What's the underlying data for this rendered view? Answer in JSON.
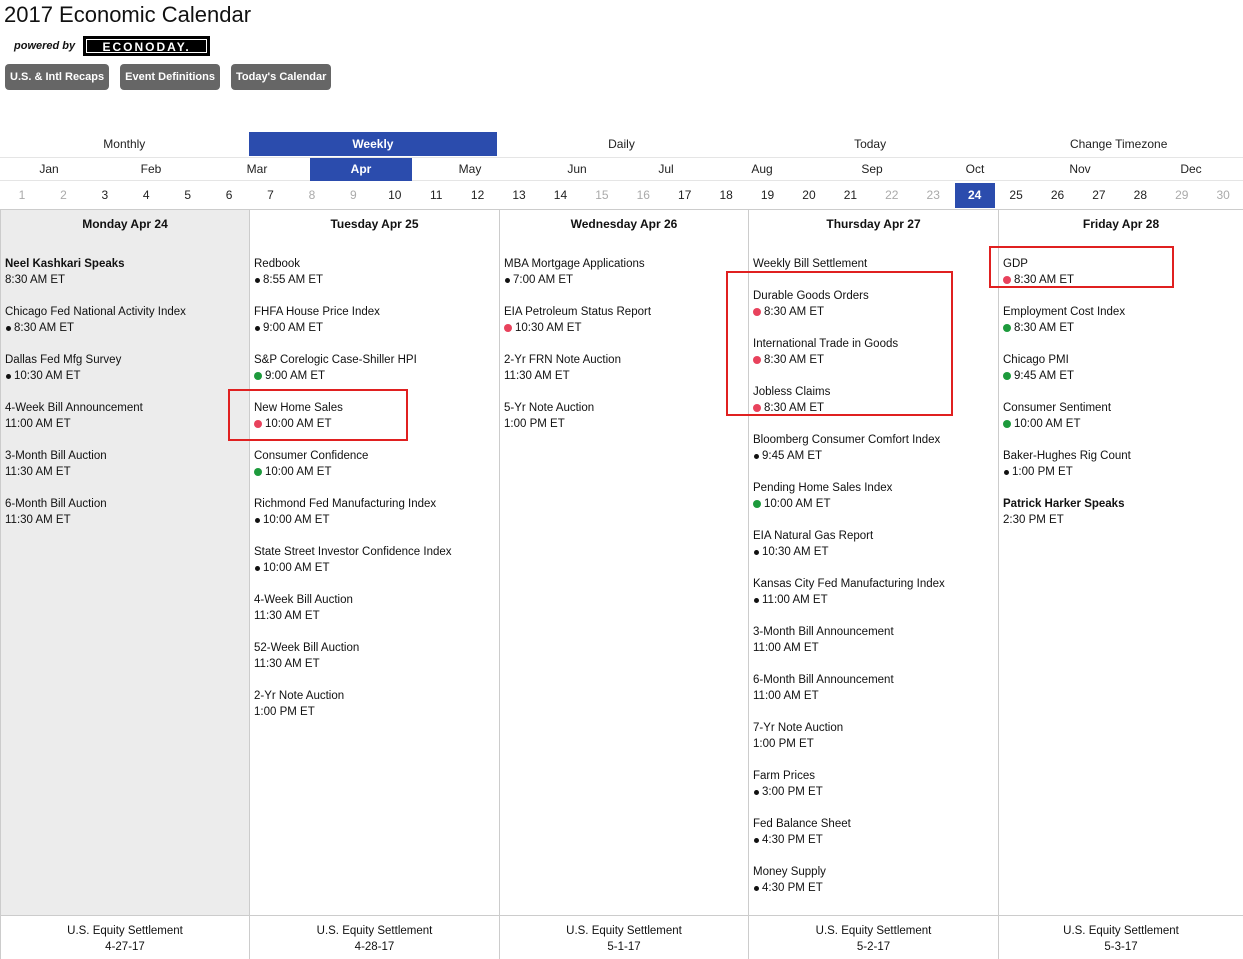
{
  "header": {
    "title": "2017 Economic Calendar",
    "powered_by": "powered by",
    "logo_text": "ECONODAY."
  },
  "buttons": [
    "U.S. & Intl Recaps",
    "Event Definitions",
    "Today's Calendar"
  ],
  "views": [
    {
      "label": "Monthly",
      "active": false
    },
    {
      "label": "Weekly",
      "active": true
    },
    {
      "label": "Daily",
      "active": false
    },
    {
      "label": "Today",
      "active": false
    },
    {
      "label": "Change Timezone",
      "active": false
    }
  ],
  "months": [
    "Jan",
    "Feb",
    "Mar",
    "Apr",
    "May",
    "Jun",
    "Jul",
    "Aug",
    "Sep",
    "Oct",
    "Nov",
    "Dec"
  ],
  "active_month": "Apr",
  "days": [
    "1",
    "2",
    "3",
    "4",
    "5",
    "6",
    "7",
    "8",
    "9",
    "10",
    "11",
    "12",
    "13",
    "14",
    "15",
    "16",
    "17",
    "18",
    "19",
    "20",
    "21",
    "22",
    "23",
    "24",
    "25",
    "26",
    "27",
    "28",
    "29",
    "30"
  ],
  "dim_days": [
    "1",
    "2",
    "8",
    "9",
    "15",
    "16",
    "22",
    "23",
    "29",
    "30"
  ],
  "active_day": "24",
  "columns": [
    {
      "heading": "Monday Apr 24",
      "shaded": true,
      "events": [
        {
          "name": "Neel Kashkari Speaks",
          "bold": true,
          "time": "8:30 AM ET",
          "dot": ""
        },
        {
          "name": "Chicago Fed National Activity Index",
          "time": "8:30 AM ET",
          "dot": "black"
        },
        {
          "name": "Dallas Fed Mfg Survey",
          "time": "10:30 AM ET",
          "dot": "black"
        },
        {
          "name": "4-Week Bill Announcement",
          "time": "11:00 AM ET",
          "dot": ""
        },
        {
          "name": "3-Month Bill Auction",
          "time": "11:30 AM ET",
          "dot": ""
        },
        {
          "name": "6-Month Bill Auction",
          "time": "11:30 AM ET",
          "dot": ""
        }
      ],
      "footer": {
        "label": "U.S. Equity Settlement",
        "date": "4-27-17"
      }
    },
    {
      "heading": "Tuesday Apr 25",
      "events": [
        {
          "name": "Redbook",
          "time": "8:55 AM ET",
          "dot": "black"
        },
        {
          "name": "FHFA House Price Index",
          "time": "9:00 AM ET",
          "dot": "black"
        },
        {
          "name": "S&P Corelogic Case-Shiller HPI",
          "time": "9:00 AM ET",
          "dot": "green"
        },
        {
          "name": "New Home Sales",
          "time": "10:00 AM ET",
          "dot": "red"
        },
        {
          "name": "Consumer Confidence",
          "time": "10:00 AM ET",
          "dot": "green"
        },
        {
          "name": "Richmond Fed Manufacturing Index",
          "time": "10:00 AM ET",
          "dot": "black"
        },
        {
          "name": "State Street Investor Confidence Index",
          "time": "10:00 AM ET",
          "dot": "black"
        },
        {
          "name": "4-Week Bill Auction",
          "time": "11:30 AM ET",
          "dot": ""
        },
        {
          "name": "52-Week Bill Auction",
          "time": "11:30 AM ET",
          "dot": ""
        },
        {
          "name": "2-Yr Note Auction",
          "time": "1:00 PM ET",
          "dot": ""
        }
      ],
      "footer": {
        "label": "U.S. Equity Settlement",
        "date": "4-28-17"
      }
    },
    {
      "heading": "Wednesday Apr 26",
      "events": [
        {
          "name": "MBA Mortgage Applications",
          "time": "7:00 AM ET",
          "dot": "black"
        },
        {
          "name": "EIA Petroleum Status Report",
          "time": "10:30 AM ET",
          "dot": "red"
        },
        {
          "name": "2-Yr FRN Note Auction",
          "time": "11:30 AM ET",
          "dot": ""
        },
        {
          "name": "5-Yr Note Auction",
          "time": "1:00 PM ET",
          "dot": ""
        }
      ],
      "footer": {
        "label": "U.S. Equity Settlement",
        "date": "5-1-17"
      }
    },
    {
      "heading": "Thursday Apr 27",
      "first_event_short": true,
      "events": [
        {
          "name": "Weekly Bill Settlement",
          "time": "",
          "dot": ""
        },
        {
          "name": "Durable Goods Orders",
          "time": "8:30 AM ET",
          "dot": "red"
        },
        {
          "name": "International Trade in Goods",
          "time": "8:30 AM ET",
          "dot": "red"
        },
        {
          "name": "Jobless Claims",
          "time": "8:30 AM ET",
          "dot": "red"
        },
        {
          "name": "Bloomberg Consumer Comfort Index",
          "time": "9:45 AM ET",
          "dot": "black"
        },
        {
          "name": "Pending Home Sales Index",
          "time": "10:00 AM ET",
          "dot": "green"
        },
        {
          "name": "EIA Natural Gas Report",
          "time": "10:30 AM ET",
          "dot": "black"
        },
        {
          "name": "Kansas City Fed Manufacturing Index",
          "time": "11:00 AM ET",
          "dot": "black"
        },
        {
          "name": "3-Month Bill Announcement",
          "time": "11:00 AM ET",
          "dot": ""
        },
        {
          "name": "6-Month Bill Announcement",
          "time": "11:00 AM ET",
          "dot": ""
        },
        {
          "name": "7-Yr Note Auction",
          "time": "1:00 PM ET",
          "dot": ""
        },
        {
          "name": "Farm Prices",
          "time": "3:00 PM ET",
          "dot": "black"
        },
        {
          "name": "Fed Balance Sheet",
          "time": "4:30 PM ET",
          "dot": "black"
        },
        {
          "name": "Money Supply",
          "time": "4:30 PM ET",
          "dot": "black"
        }
      ],
      "footer": {
        "label": "U.S. Equity Settlement",
        "date": "5-2-17"
      }
    },
    {
      "heading": "Friday Apr 28",
      "events": [
        {
          "name": "GDP",
          "time": "8:30 AM ET",
          "dot": "red"
        },
        {
          "name": "Employment Cost Index",
          "time": "8:30 AM ET",
          "dot": "green"
        },
        {
          "name": "Chicago PMI",
          "time": "9:45 AM ET",
          "dot": "green"
        },
        {
          "name": "Consumer Sentiment",
          "time": "10:00 AM ET",
          "dot": "green"
        },
        {
          "name": "Baker-Hughes Rig Count",
          "time": "1:00 PM ET",
          "dot": "black"
        },
        {
          "name": "Patrick Harker Speaks",
          "bold": true,
          "time": "2:30 PM ET",
          "dot": ""
        }
      ],
      "footer": {
        "label": "U.S. Equity Settlement",
        "date": "5-3-17"
      }
    }
  ],
  "colors": {
    "accent": "#2b4cad",
    "button_bg": "#666666",
    "highlight_box": "#e02020",
    "dot_red": "#e8425c",
    "dot_green": "#1d9a3c",
    "shaded_col": "#ececec"
  }
}
